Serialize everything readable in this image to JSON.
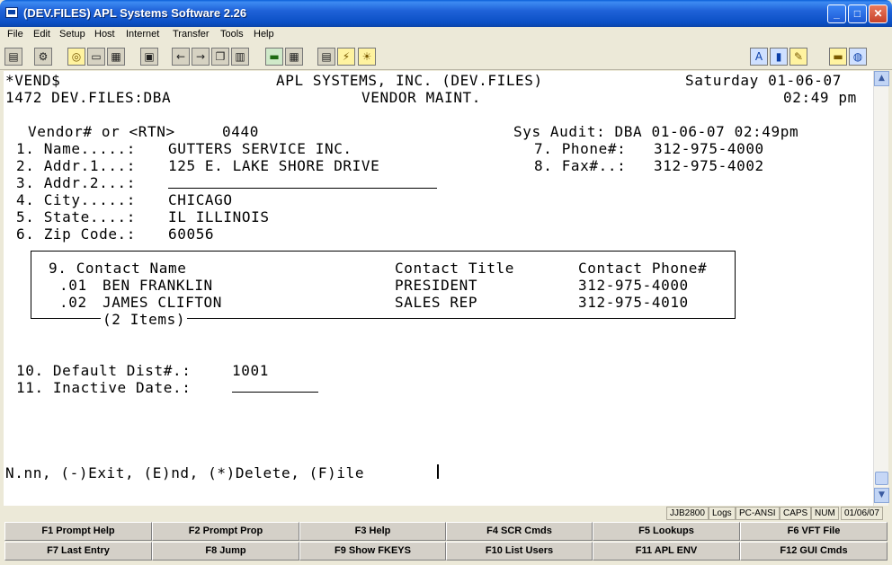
{
  "window": {
    "title": "(DEV.FILES) APL Systems Software 2.26",
    "controls": {
      "minimize": "_",
      "maximize": "□",
      "close": "✕"
    }
  },
  "menu": [
    "File",
    "Edit",
    "Setup",
    "Host",
    "Internet",
    "Transfer",
    "Tools",
    "Help"
  ],
  "toolbar": {
    "icons": [
      "print-icon",
      "connect-icon",
      "find-icon",
      "window-icon",
      "keyboard-icon",
      "save-icon",
      "arrow-left-icon",
      "arrow-right-icon",
      "copy-icon",
      "paste-icon",
      "terminal-icon",
      "grid-icon",
      "printer-icon",
      "lightning-icon",
      "lightbulb-icon",
      "font-icon",
      "chart-icon",
      "note-icon",
      "folder-icon",
      "globe-icon"
    ]
  },
  "terminal": {
    "header": {
      "program": "*VEND$",
      "company": "APL SYSTEMS, INC. (DEV.FILES)",
      "date": "Saturday 01-06-07",
      "session": "1472 DEV.FILES:DBA",
      "screen_title": "VENDOR MAINT.",
      "time": "02:49 pm"
    },
    "vendor_prompt": "Vendor# or <RTN>",
    "vendor_number": "0440",
    "sys_audit": "Sys Audit: DBA 01-06-07 02:49pm",
    "fields": {
      "name_label": "1. Name.....:",
      "name_value": "GUTTERS SERVICE INC.",
      "addr1_label": "2. Addr.1...:",
      "addr1_value": "125 E. LAKE SHORE DRIVE",
      "addr2_label": "3. Addr.2...:",
      "addr2_value": "",
      "city_label": "4. City.....:",
      "city_value": "CHICAGO",
      "state_label": "5. State....:",
      "state_value": "IL ILLINOIS",
      "zip_label": "6. Zip Code.:",
      "zip_value": "60056",
      "phone_label": "7. Phone#:",
      "phone_value": "312-975-4000",
      "fax_label": "8. Fax#..:",
      "fax_value": "312-975-4002",
      "dist_label": "10. Default Dist#.:",
      "dist_value": "1001",
      "inactive_label": "11. Inactive Date.:",
      "inactive_value": ""
    },
    "contacts": {
      "headers": [
        "9. Contact Name",
        "Contact Title",
        "Contact Phone#"
      ],
      "rows": [
        {
          "num": ".01",
          "name": "BEN FRANKLIN",
          "title": "PRESIDENT",
          "phone": "312-975-4000"
        },
        {
          "num": ".02",
          "name": "JAMES CLIFTON",
          "title": "SALES REP",
          "phone": "312-975-4010"
        }
      ],
      "count_label": "(2 Items)"
    },
    "command_line": "N.nn, (-)Exit, (E)nd, (*)Delete, (F)ile"
  },
  "status": {
    "user": "JJB2800",
    "logs": "Logs",
    "emulation": "PC-ANSI",
    "caps": "CAPS",
    "num": "NUM",
    "date": "01/06/07"
  },
  "fkeys": [
    "F1 Prompt Help",
    "F2 Prompt Prop",
    "F3 Help",
    "F4 SCR Cmds",
    "F5 Lookups",
    "F6 VFT File",
    "F7 Last Entry",
    "F8 Jump",
    "F9 Show FKEYS",
    "F10 List Users",
    "F11 APL ENV",
    "F12 GUI Cmds"
  ]
}
